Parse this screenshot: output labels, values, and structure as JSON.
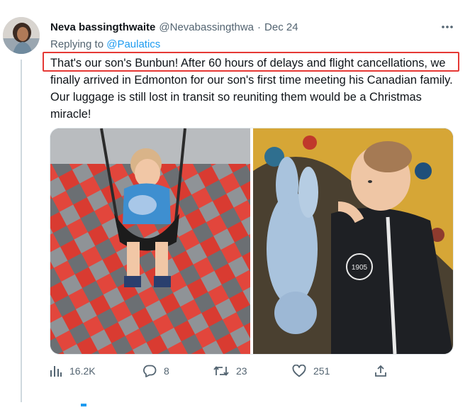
{
  "tweet": {
    "author_name": "Neva bassingthwaite",
    "author_handle": "@Nevabassingthwa",
    "separator": "·",
    "date": "Dec 24",
    "reply_prefix": "Replying to",
    "reply_to": "@Paulatics",
    "text": "That's our son's Bunbun! After 60 hours of delays and flight cancellations, we finally arrived in Edmonton for our son's first time meeting his Canadian family. Our luggage is still lost in transit so reuniting them would be a Christmas miracle!"
  },
  "media": {
    "photos": [
      {
        "icon": "toddler-on-swing-photo"
      },
      {
        "icon": "baby-with-bunny-plush-photo",
        "onesie_text": "1905"
      }
    ]
  },
  "actions": {
    "views": "16.2K",
    "replies": "8",
    "retweets": "23",
    "likes": "251"
  },
  "colors": {
    "link": "#1d9bf0",
    "secondary_text": "#536471",
    "highlight": "#e53935"
  }
}
